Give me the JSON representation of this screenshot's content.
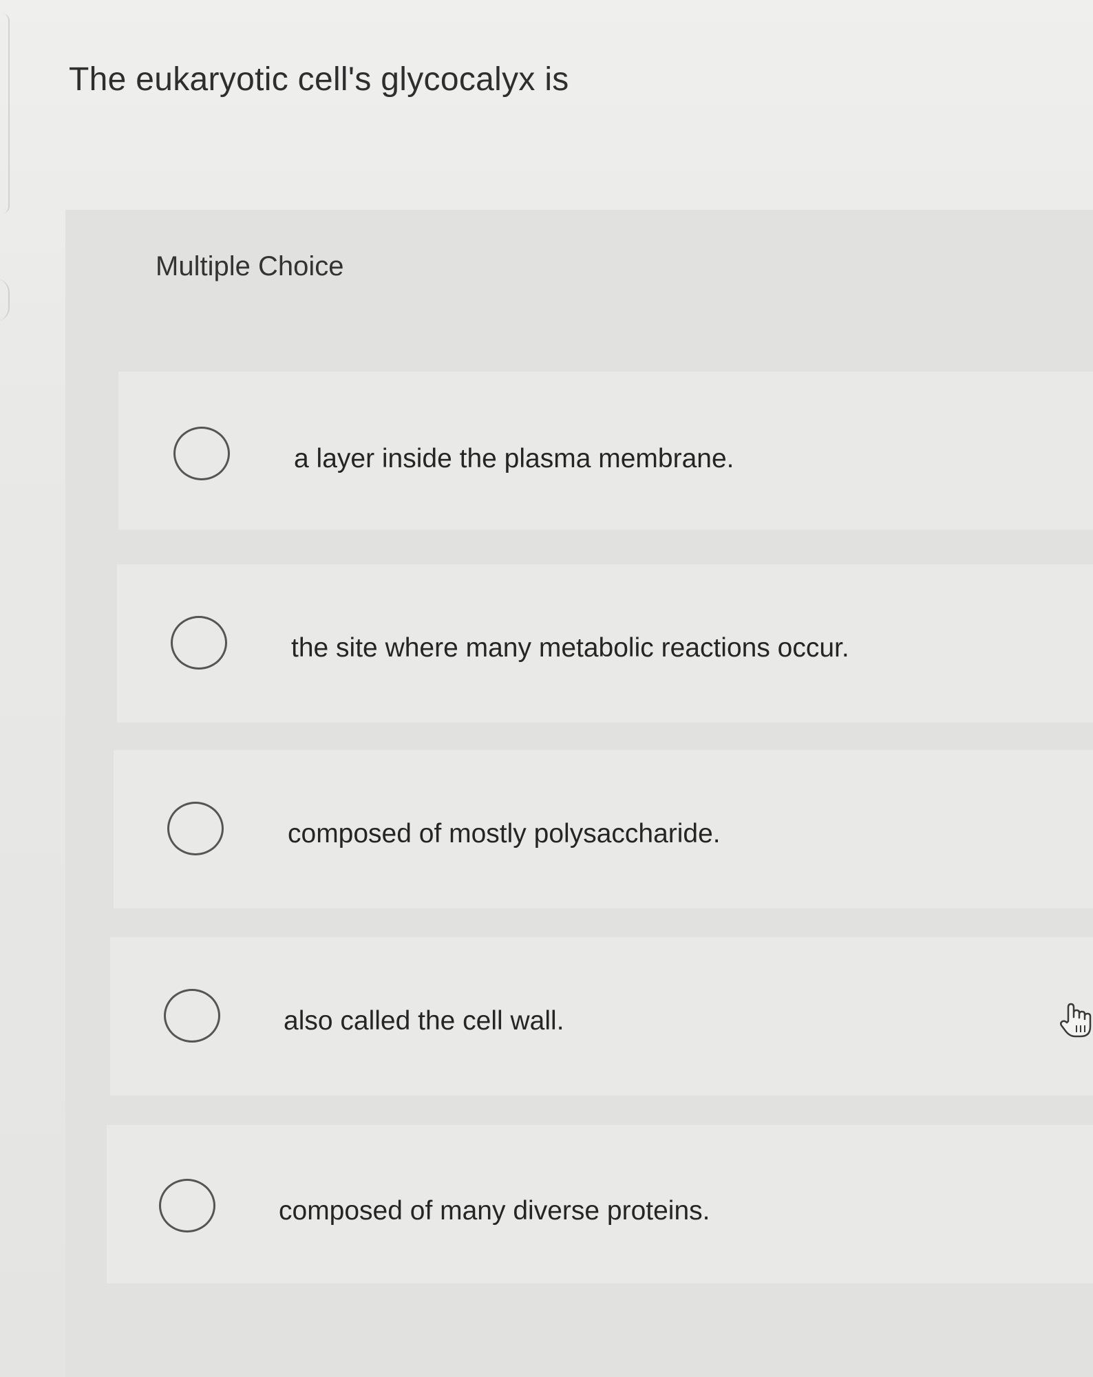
{
  "question": {
    "title": "The eukaryotic cell's glycocalyx is",
    "type_label": "Multiple Choice"
  },
  "choices": [
    {
      "label": "a layer inside the plasma membrane.",
      "selected": false
    },
    {
      "label": "the site where many metabolic reactions occur.",
      "selected": false
    },
    {
      "label": "composed of mostly polysaccharide.",
      "selected": false
    },
    {
      "label": "also called the cell wall.",
      "selected": false
    },
    {
      "label": "composed of many diverse proteins.",
      "selected": false
    }
  ],
  "cursor": {
    "icon": "hand-pointer-icon"
  },
  "colors": {
    "background": "#e6e6e4",
    "panel": "#e1e1df",
    "text": "#2b2b2b",
    "radio_border": "#555555"
  }
}
